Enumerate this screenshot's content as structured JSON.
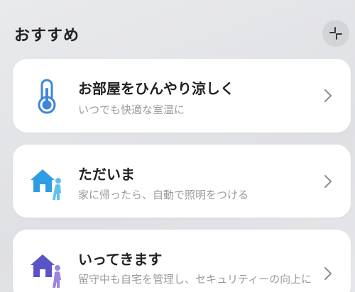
{
  "section": {
    "title": "おすすめ"
  },
  "cards": [
    {
      "title": "お部屋をひんやり涼しく",
      "subtitle": "いつでも快適な室温に",
      "icon": "thermometer-icon"
    },
    {
      "title": "ただいま",
      "subtitle": "家に帰ったら、自動で照明をつける",
      "icon": "arriving-home-icon"
    },
    {
      "title": "いってきます",
      "subtitle": "留守中も自宅を管理し、セキュリティーの向上に",
      "icon": "leaving-home-icon"
    }
  ],
  "colors": {
    "thermometer": "#3d86d8",
    "arrive_house": "#2f9ce6",
    "arrive_person": "#5fc2ec",
    "leave_house": "#5b54c4",
    "leave_person": "#9a84e0",
    "chevron": "#8c8c8c"
  }
}
